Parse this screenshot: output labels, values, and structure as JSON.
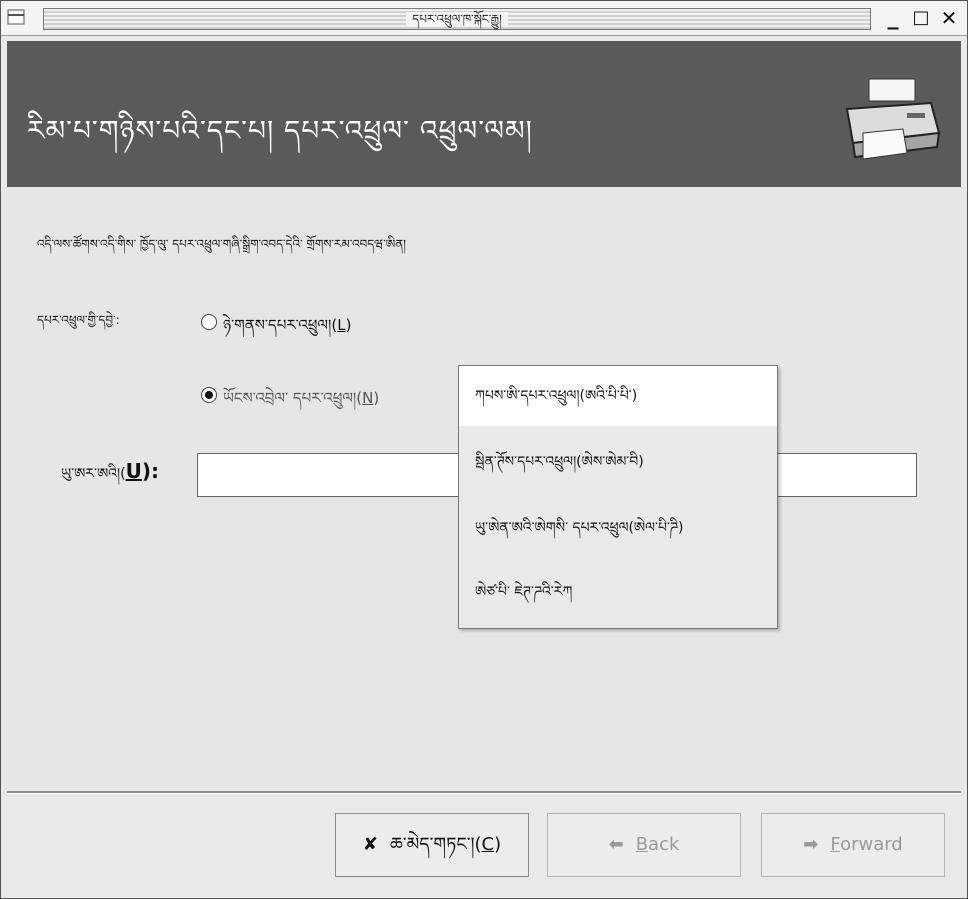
{
  "window": {
    "title": "དཔར་འཕྲུལ་ཁ་སྐོང་རྒྱུ།",
    "minimize_glyph": "_",
    "maximize_glyph": "□",
    "close_glyph": "✕"
  },
  "header": {
    "title": "རིམ་པ་གཉིས་པའི་དང་པ། དཔར་འཕྲུལ་ འཕྲུལ་ལམ།",
    "icon": "printer-icon"
  },
  "main": {
    "intro": "འདི་ལས་ཚོགས་འདི་གིས་ ཁྱོད་ལུ་ དཔར་འཕྲུལ་གཞི་སྒྲིག་འབད་དེའི་ གྲོགས་རམ་འབདཝ་ཨིན།",
    "device_label": "དཔར་འཕྲུལ་གྱི་དབྱེ་:",
    "radio_local": "ཉེ་གནས་དཔར་འཕྲུལ།(",
    "radio_local_key": "L",
    "radio_network": "ཡོངས་འབྲེལ་ དཔར་འཕྲུལ།(",
    "radio_network_key": "N",
    "uri_label": "ཡུ་ཨར་ཨའི།(",
    "uri_key": "U",
    "uri_label_end": "):",
    "uri_value": ""
  },
  "menu": {
    "items": [
      {
        "label": "ཀཔས་ཨི་དཔར་འཕྲུལ།(ཨའི་པི་པི་)"
      },
      {
        "label": "སྦིན་ཊོས་དཔར་འཕྲུལ།(ཨེས་ཨེམ་བི)"
      },
      {
        "label": "ཡུ་ཨེན་ཨའི་ཨེགསི་ དཔར་འཕྲུལ(ཨེལ་པི་ཌི)"
      },
      {
        "label": "ཨེཙ་པི་ ཇེཊ་ཌའི་རེཀ"
      }
    ]
  },
  "buttons": {
    "cancel": "ཆ་མེད་གཏང་།(",
    "cancel_key": "C",
    "back": "Back",
    "back_key": "B",
    "forward": "Forward",
    "forward_key": "F"
  }
}
